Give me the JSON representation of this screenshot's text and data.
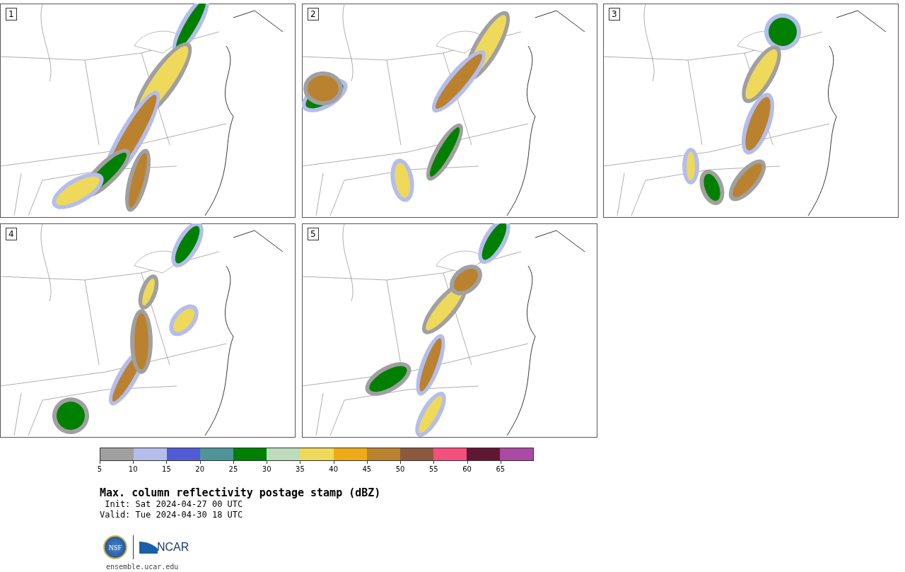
{
  "panels": [
    {
      "label": "1",
      "kind": "map-picture"
    },
    {
      "label": "2",
      "kind": "map-picture"
    },
    {
      "label": "3",
      "kind": "map-picture"
    },
    {
      "label": "4",
      "kind": "map-picture"
    },
    {
      "label": "5",
      "kind": "map-picture"
    }
  ],
  "legend": {
    "bins": [
      {
        "color": "#a0a0a0"
      },
      {
        "color": "#b4bdec"
      },
      {
        "color": "#505bd6"
      },
      {
        "color": "#4e9499"
      },
      {
        "color": "#008000"
      },
      {
        "color": "#bcdcbc"
      },
      {
        "color": "#eed95a"
      },
      {
        "color": "#efab17"
      },
      {
        "color": "#ba822f"
      },
      {
        "color": "#8b5a3e"
      },
      {
        "color": "#f54f7d"
      },
      {
        "color": "#611733"
      },
      {
        "color": "#ab4aa2"
      }
    ],
    "ticks": [
      "5",
      "10",
      "15",
      "20",
      "25",
      "30",
      "35",
      "40",
      "45",
      "50",
      "55",
      "60",
      "65"
    ]
  },
  "title": "Max. column reflectivity postage stamp (dBZ)",
  "init": " Init: Sat 2024-04-27 00 UTC",
  "valid": "Valid: Tue 2024-04-30 18 UTC",
  "logos": {
    "nsf": "NSF",
    "ncar": "NCAR"
  },
  "url": "ensemble.ucar.edu"
}
